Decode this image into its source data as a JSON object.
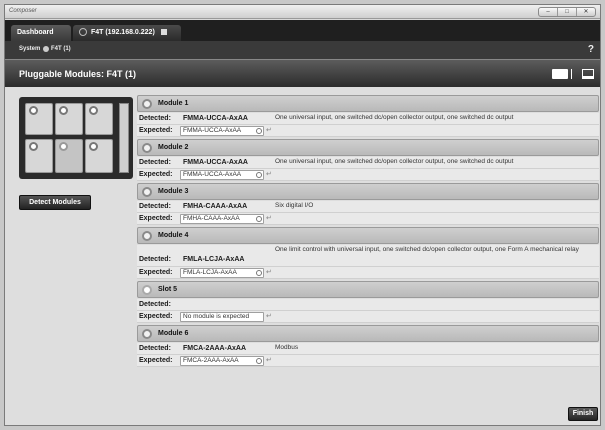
{
  "window": {
    "app_name": "Composer",
    "controls": [
      "–",
      "□",
      "✕"
    ]
  },
  "tabs": [
    {
      "label": "Dashboard"
    },
    {
      "label": "F4T (192.168.0.222)"
    }
  ],
  "breadcrumb": {
    "system": "System",
    "device": "F4T (1)"
  },
  "help_icon": "?",
  "page": {
    "title": "Pluggable Modules: F4T (1)"
  },
  "labels": {
    "detected": "Detected:",
    "expected": "Expected:"
  },
  "detect_button": "Detect Modules",
  "finish_button": "Finish",
  "modules": [
    {
      "name": "Module 1",
      "detected": "FMMA-UCCA-AxAA",
      "description": "One universal input, one switched dc/open collector output, one switched dc output",
      "expected": "FMMA-UCCA-AxAA"
    },
    {
      "name": "Module 2",
      "detected": "FMMA-UCCA-AxAA",
      "description": "One universal input, one switched dc/open collector output, one switched dc output",
      "expected": "FMMA-UCCA-AxAA"
    },
    {
      "name": "Module 3",
      "detected": "FMHA-CAAA-AxAA",
      "description": "Six digital I/O",
      "expected": "FMHA-CAAA-AxAA"
    },
    {
      "name": "Module 4",
      "detected": "FMLA-LCJA-AxAA",
      "description": "One limit control with universal input, one switched dc/open collector output, one Form A mechanical relay",
      "expected": "FMLA-LCJA-AxAA"
    },
    {
      "name": "Slot 5",
      "detected": "",
      "description": "",
      "expected": "No module is expected"
    },
    {
      "name": "Module 6",
      "detected": "FMCA-2AAA-AxAA",
      "description": "Modbus",
      "expected": "FMCA-2AAA-AxAA"
    }
  ]
}
